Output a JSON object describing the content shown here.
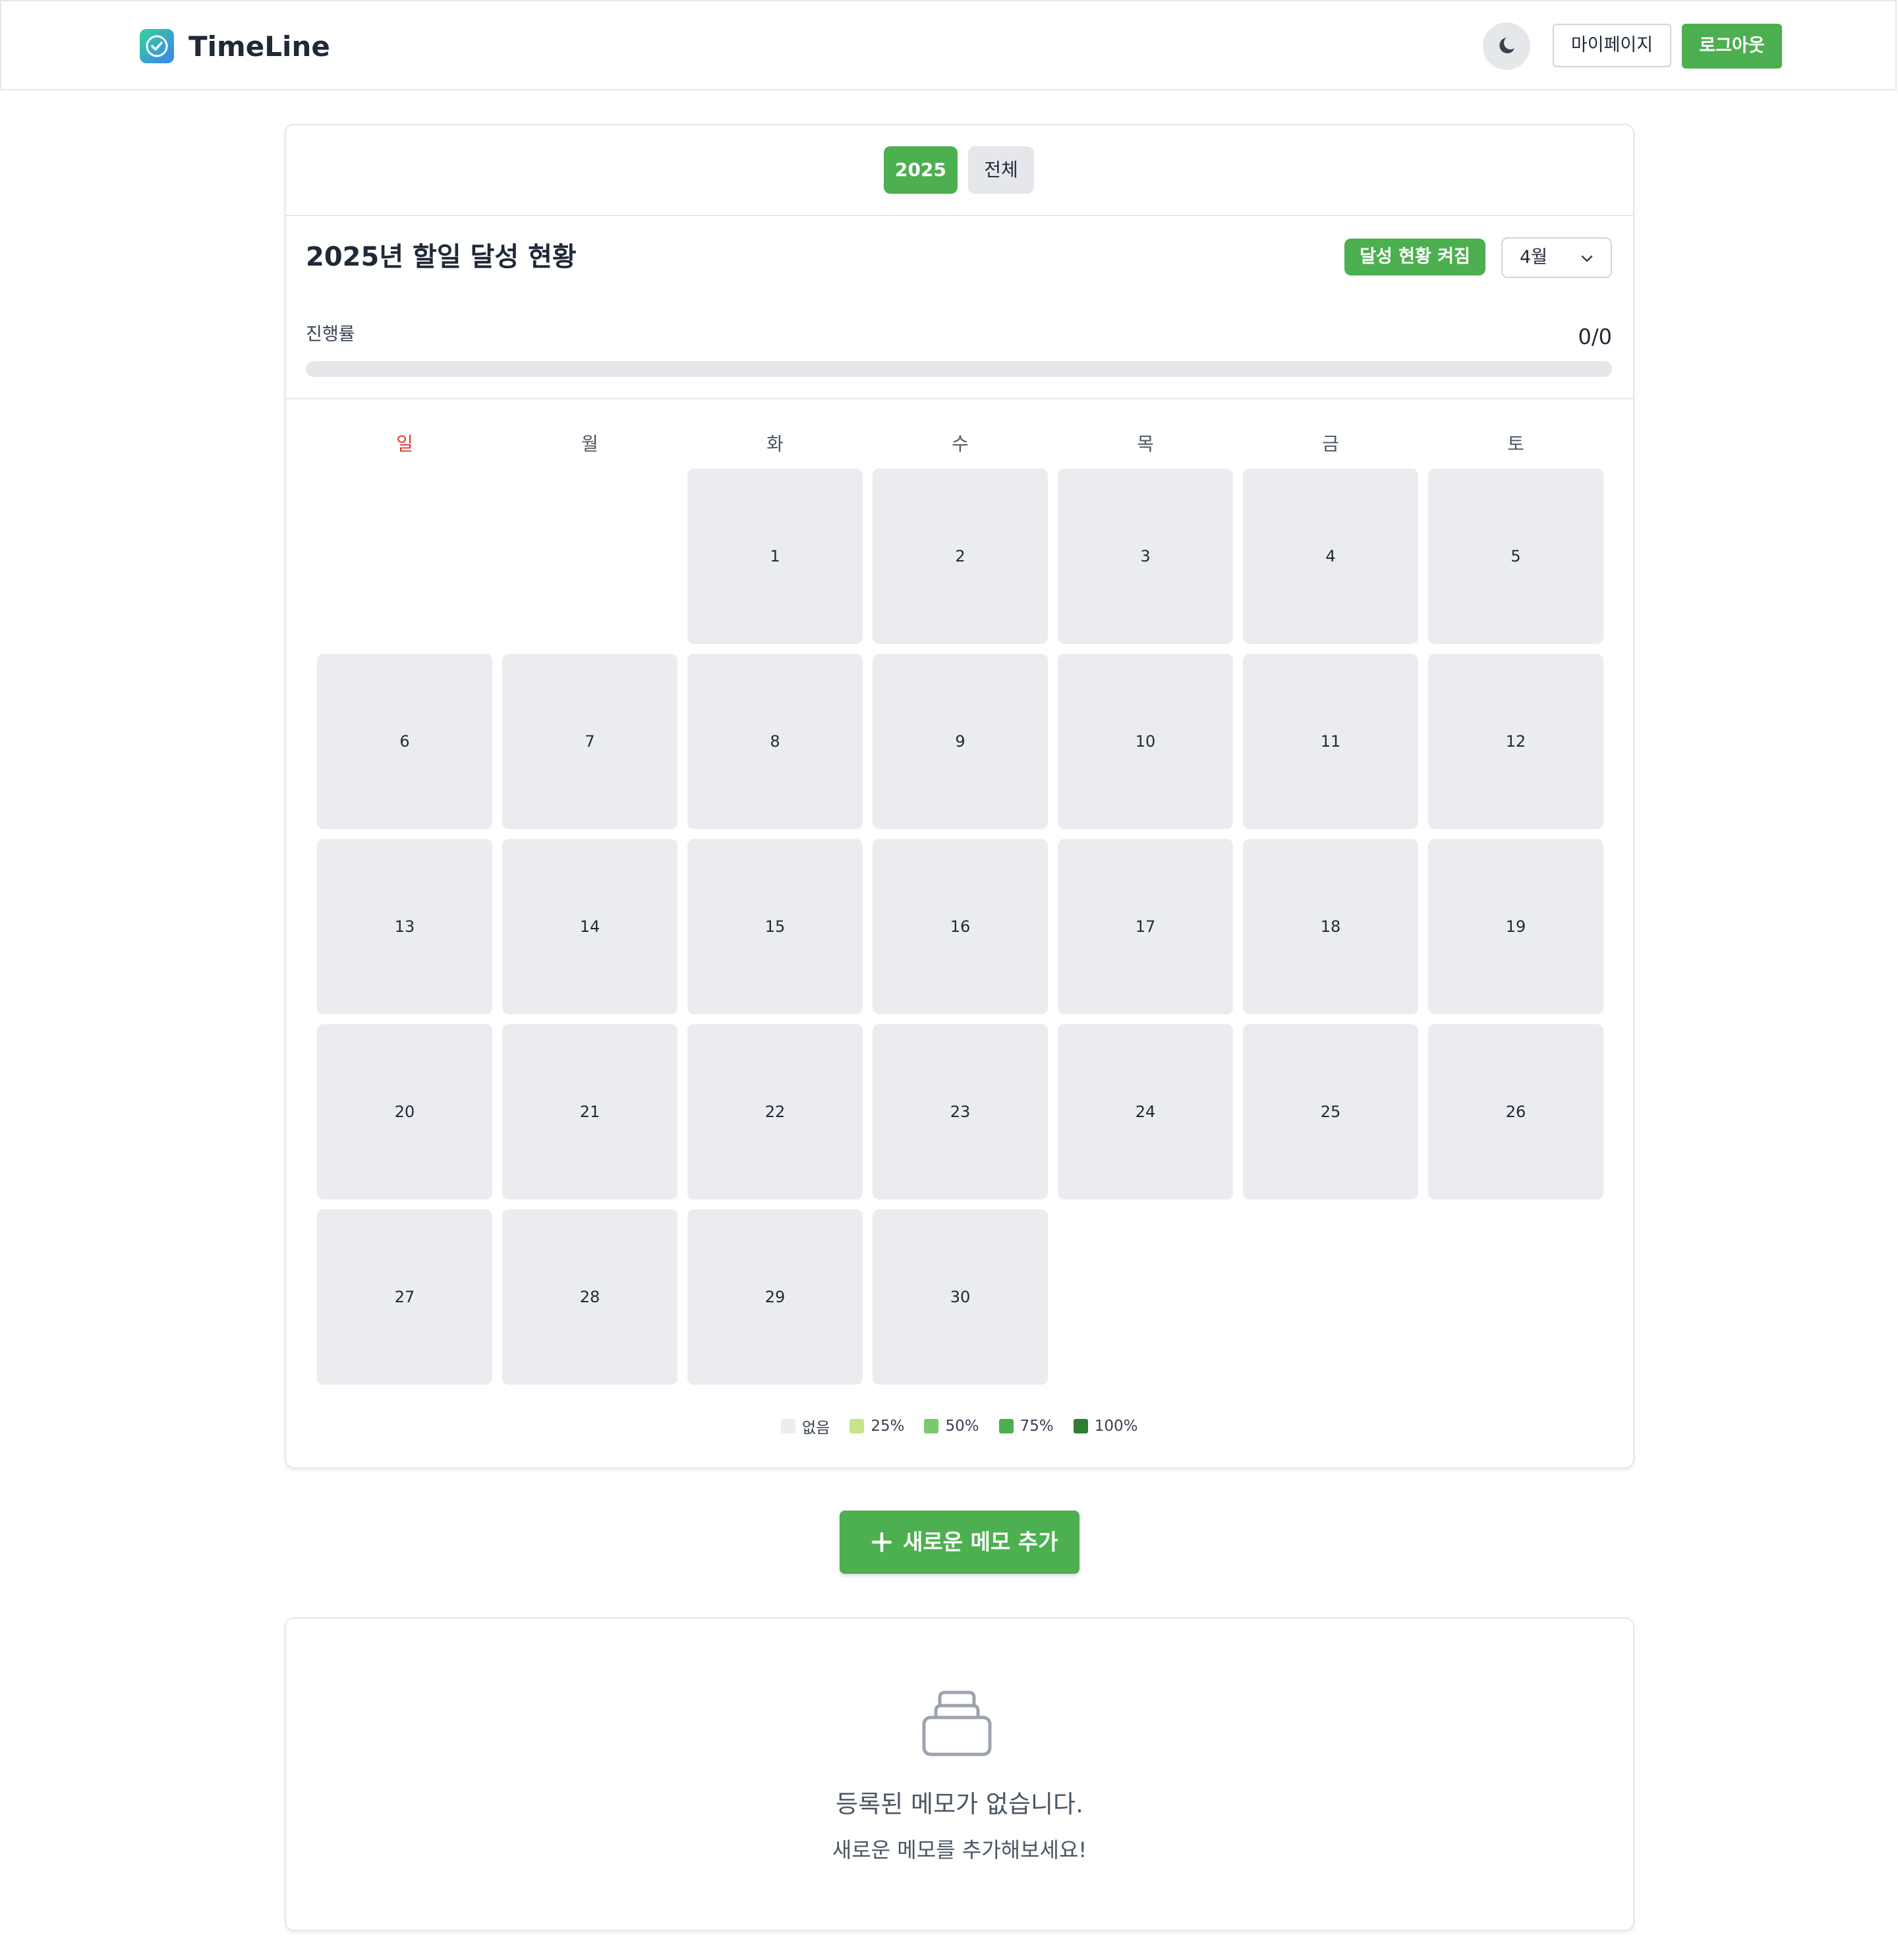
{
  "header": {
    "brand": "TimeLine",
    "logo_icon": "check-circle-icon",
    "theme_icon": "moon-icon",
    "mypage_label": "마이페이지",
    "logout_label": "로그아웃"
  },
  "year_tabs": {
    "active": "2025",
    "all": "전체"
  },
  "stats": {
    "title": "2025년 할일 달성 현황",
    "toggle_badge": "달성 현황 켜짐",
    "month_value": "4월",
    "progress_label": "진행률",
    "progress_count": "0/0",
    "progress_fraction": 0
  },
  "calendar": {
    "weekdays": [
      "일",
      "월",
      "화",
      "수",
      "목",
      "금",
      "토"
    ],
    "first_weekday_index": 2,
    "days_in_month": 30,
    "days": [
      "1",
      "2",
      "3",
      "4",
      "5",
      "6",
      "7",
      "8",
      "9",
      "10",
      "11",
      "12",
      "13",
      "14",
      "15",
      "16",
      "17",
      "18",
      "19",
      "20",
      "21",
      "22",
      "23",
      "24",
      "25",
      "26",
      "27",
      "28",
      "29",
      "30"
    ]
  },
  "legend": [
    {
      "label": "없음",
      "color": "#ebedf0"
    },
    {
      "label": "25%",
      "color": "#c6e48b"
    },
    {
      "label": "50%",
      "color": "#7bc96f"
    },
    {
      "label": "75%",
      "color": "#4caf50"
    },
    {
      "label": "100%",
      "color": "#2e7d32"
    }
  ],
  "add_memo_label": "새로운 메모 추가",
  "empty_state": {
    "icon": "inbox-icon",
    "title": "등록된 메모가 없습니다.",
    "subtitle": "새로운 메모를 추가해보세요!"
  },
  "colors": {
    "accent": "#4caf50",
    "sunday": "#e53935",
    "cell_empty": "#ebecef",
    "border": "#e5e7eb"
  }
}
